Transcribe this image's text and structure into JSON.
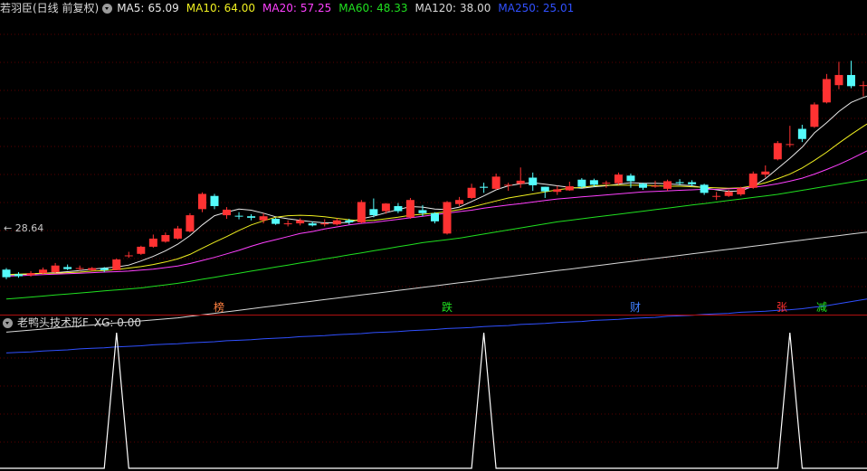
{
  "main_chart": {
    "title": "若羽臣(日线 前复权)",
    "ma_legend": [
      {
        "name": "MA5",
        "value": "65.09",
        "color": "#e8e8e8"
      },
      {
        "name": "MA10",
        "value": "64.00",
        "color": "#f0f020"
      },
      {
        "name": "MA20",
        "value": "57.25",
        "color": "#ff40ff"
      },
      {
        "name": "MA60",
        "value": "48.33",
        "color": "#20e020"
      },
      {
        "name": "MA120",
        "value": "38.00",
        "color": "#d8d8d8"
      },
      {
        "name": "MA250",
        "value": "25.01",
        "color": "#3050ff"
      }
    ],
    "low_label": "← 28.64",
    "markers": [
      {
        "text": "榜",
        "color": "#ff8040",
        "x": 242
      },
      {
        "text": "跌",
        "color": "#20e020",
        "x": 494
      },
      {
        "text": "财",
        "color": "#4080ff",
        "x": 702
      },
      {
        "text": "张",
        "color": "#ff3030",
        "x": 864
      },
      {
        "text": "减",
        "color": "#20e020",
        "x": 908
      }
    ]
  },
  "indicator": {
    "title": "老鸭头技术形F",
    "value_label": "XG: 0.00"
  },
  "chart_data": [
    {
      "type": "candlestick",
      "title": "若羽臣(日线 前复权)",
      "ylim": [
        22,
        80
      ],
      "bars": [
        {
          "o": 30.5,
          "c": 29.0,
          "h": 30.8,
          "l": 28.6
        },
        {
          "o": 29.6,
          "c": 29.2,
          "h": 30.0,
          "l": 28.9
        },
        {
          "o": 29.4,
          "c": 29.8,
          "h": 30.2,
          "l": 29.1
        },
        {
          "o": 29.8,
          "c": 30.5,
          "h": 30.9,
          "l": 29.5
        },
        {
          "o": 30.0,
          "c": 31.3,
          "h": 31.8,
          "l": 29.8
        },
        {
          "o": 31.0,
          "c": 30.6,
          "h": 31.5,
          "l": 30.4
        },
        {
          "o": 30.8,
          "c": 30.8,
          "h": 31.3,
          "l": 30.3
        },
        {
          "o": 30.4,
          "c": 30.8,
          "h": 31.0,
          "l": 30.2
        },
        {
          "o": 30.8,
          "c": 30.4,
          "h": 31.0,
          "l": 30.0
        },
        {
          "o": 30.4,
          "c": 32.5,
          "h": 32.7,
          "l": 30.4
        },
        {
          "o": 33.2,
          "c": 33.3,
          "h": 34.0,
          "l": 32.8
        },
        {
          "o": 33.6,
          "c": 35.0,
          "h": 35.2,
          "l": 33.4
        },
        {
          "o": 35.0,
          "c": 36.6,
          "h": 37.4,
          "l": 34.8
        },
        {
          "o": 36.0,
          "c": 37.3,
          "h": 37.8,
          "l": 35.8
        },
        {
          "o": 36.6,
          "c": 38.6,
          "h": 39.1,
          "l": 36.4
        },
        {
          "o": 38.0,
          "c": 41.2,
          "h": 41.6,
          "l": 37.8
        },
        {
          "o": 42.4,
          "c": 45.4,
          "h": 45.7,
          "l": 41.8
        },
        {
          "o": 45.0,
          "c": 43.0,
          "h": 45.4,
          "l": 42.4
        },
        {
          "o": 41.2,
          "c": 42.3,
          "h": 42.8,
          "l": 40.5
        },
        {
          "o": 41.1,
          "c": 41.0,
          "h": 41.8,
          "l": 40.4
        },
        {
          "o": 41.0,
          "c": 40.7,
          "h": 41.4,
          "l": 40.2
        },
        {
          "o": 40.2,
          "c": 41.0,
          "h": 41.6,
          "l": 39.6
        },
        {
          "o": 40.5,
          "c": 39.5,
          "h": 40.7,
          "l": 39.3
        },
        {
          "o": 39.6,
          "c": 39.6,
          "h": 40.2,
          "l": 39.0
        },
        {
          "o": 39.6,
          "c": 40.2,
          "h": 40.6,
          "l": 39.2
        },
        {
          "o": 39.6,
          "c": 39.2,
          "h": 40.0,
          "l": 39.0
        },
        {
          "o": 39.4,
          "c": 39.6,
          "h": 40.4,
          "l": 39.0
        },
        {
          "o": 39.4,
          "c": 40.2,
          "h": 40.6,
          "l": 39.2
        },
        {
          "o": 40.2,
          "c": 39.8,
          "h": 40.5,
          "l": 39.4
        },
        {
          "o": 39.8,
          "c": 43.8,
          "h": 44.2,
          "l": 39.6
        },
        {
          "o": 42.4,
          "c": 41.2,
          "h": 44.5,
          "l": 40.8
        },
        {
          "o": 42.0,
          "c": 43.5,
          "h": 43.6,
          "l": 41.5
        },
        {
          "o": 43.0,
          "c": 42.0,
          "h": 43.6,
          "l": 41.6
        },
        {
          "o": 40.8,
          "c": 44.2,
          "h": 44.6,
          "l": 40.5
        },
        {
          "o": 42.2,
          "c": 41.6,
          "h": 43.2,
          "l": 41.0
        },
        {
          "o": 41.6,
          "c": 40.0,
          "h": 41.8,
          "l": 39.6
        },
        {
          "o": 37.6,
          "c": 43.8,
          "h": 44.0,
          "l": 37.4
        },
        {
          "o": 43.4,
          "c": 44.2,
          "h": 44.8,
          "l": 43.0
        },
        {
          "o": 44.6,
          "c": 46.6,
          "h": 47.4,
          "l": 44.4
        },
        {
          "o": 46.8,
          "c": 46.6,
          "h": 47.6,
          "l": 45.6
        },
        {
          "o": 46.4,
          "c": 48.8,
          "h": 49.4,
          "l": 46.2
        },
        {
          "o": 47.2,
          "c": 47.2,
          "h": 47.6,
          "l": 46.0
        },
        {
          "o": 47.4,
          "c": 48.0,
          "h": 50.6,
          "l": 46.6
        },
        {
          "o": 48.6,
          "c": 47.1,
          "h": 49.6,
          "l": 46.0
        },
        {
          "o": 46.8,
          "c": 45.9,
          "h": 46.8,
          "l": 44.6
        },
        {
          "o": 45.8,
          "c": 46.3,
          "h": 47.0,
          "l": 45.2
        },
        {
          "o": 46.1,
          "c": 46.9,
          "h": 47.8,
          "l": 46.0
        },
        {
          "o": 48.2,
          "c": 46.8,
          "h": 48.5,
          "l": 46.5
        },
        {
          "o": 48.1,
          "c": 47.2,
          "h": 48.4,
          "l": 46.8
        },
        {
          "o": 47.6,
          "c": 47.6,
          "h": 48.0,
          "l": 46.6
        },
        {
          "o": 47.5,
          "c": 49.2,
          "h": 49.6,
          "l": 47.2
        },
        {
          "o": 49.0,
          "c": 47.9,
          "h": 49.4,
          "l": 46.6
        },
        {
          "o": 47.4,
          "c": 46.6,
          "h": 47.6,
          "l": 46.2
        },
        {
          "o": 47.0,
          "c": 47.0,
          "h": 48.0,
          "l": 46.6
        },
        {
          "o": 46.4,
          "c": 47.9,
          "h": 48.2,
          "l": 46.0
        },
        {
          "o": 47.7,
          "c": 47.5,
          "h": 48.3,
          "l": 47.1
        },
        {
          "o": 47.7,
          "c": 47.3,
          "h": 48.1,
          "l": 46.9
        },
        {
          "o": 47.2,
          "c": 45.6,
          "h": 47.4,
          "l": 45.2
        },
        {
          "o": 45.0,
          "c": 45.0,
          "h": 45.8,
          "l": 44.2
        },
        {
          "o": 45.0,
          "c": 45.8,
          "h": 46.2,
          "l": 44.8
        },
        {
          "o": 45.3,
          "c": 46.5,
          "h": 46.8,
          "l": 45.0
        },
        {
          "o": 46.6,
          "c": 49.4,
          "h": 49.8,
          "l": 46.4
        },
        {
          "o": 49.2,
          "c": 49.8,
          "h": 51.0,
          "l": 48.6
        },
        {
          "o": 52.2,
          "c": 55.4,
          "h": 55.8,
          "l": 52.0
        },
        {
          "o": 55.2,
          "c": 55.2,
          "h": 58.8,
          "l": 54.6
        },
        {
          "o": 58.2,
          "c": 56.2,
          "h": 59.0,
          "l": 55.6
        },
        {
          "o": 58.6,
          "c": 63.0,
          "h": 63.4,
          "l": 58.4
        },
        {
          "o": 63.4,
          "c": 68.0,
          "h": 69.0,
          "l": 63.2
        },
        {
          "o": 66.8,
          "c": 68.8,
          "h": 71.4,
          "l": 66.0
        },
        {
          "o": 68.8,
          "c": 66.6,
          "h": 71.6,
          "l": 66.2
        },
        {
          "o": 66.8,
          "c": 66.8,
          "h": 67.6,
          "l": 64.6
        }
      ],
      "moving_averages": [
        {
          "name": "MA5",
          "color": "#e8e8e8",
          "values": [
            29.4,
            29.5,
            29.6,
            29.8,
            29.9,
            30.1,
            30.3,
            30.6,
            30.8,
            31.0,
            31.4,
            32.2,
            33.1,
            34.2,
            35.5,
            37.2,
            39.3,
            41.1,
            41.8,
            42.4,
            42.2,
            41.6,
            40.9,
            40.5,
            40.2,
            39.9,
            39.7,
            39.7,
            39.8,
            40.5,
            41.0,
            41.7,
            42.3,
            42.9,
            42.8,
            42.4,
            42.3,
            42.8,
            43.9,
            45.0,
            46.2,
            47.0,
            47.4,
            47.6,
            47.3,
            47.0,
            46.7,
            46.5,
            46.8,
            47.0,
            47.3,
            47.6,
            47.5,
            47.5,
            47.4,
            47.2,
            47.0,
            46.6,
            46.2,
            45.9,
            46.0,
            46.9,
            48.4,
            50.4,
            52.4,
            54.6,
            57.4,
            59.4,
            61.6,
            63.4,
            64.4,
            65.1
          ]
        },
        {
          "name": "MA10",
          "color": "#f0f020",
          "values": [
            29.5,
            29.6,
            29.7,
            29.8,
            29.8,
            29.9,
            30.0,
            30.2,
            30.3,
            30.5,
            30.8,
            31.1,
            31.5,
            32.0,
            32.6,
            33.5,
            34.7,
            35.9,
            37.0,
            38.2,
            39.3,
            40.1,
            40.8,
            41.1,
            41.2,
            41.1,
            40.9,
            40.6,
            40.3,
            40.1,
            40.2,
            40.5,
            40.8,
            41.2,
            41.4,
            41.6,
            41.9,
            42.3,
            42.8,
            43.4,
            44.0,
            44.6,
            45.0,
            45.4,
            45.8,
            46.2,
            46.5,
            46.7,
            47.0,
            47.1,
            47.1,
            47.1,
            47.1,
            47.0,
            46.9,
            46.9,
            46.8,
            46.7,
            46.6,
            46.5,
            46.6,
            47.0,
            47.6,
            48.4,
            49.3,
            50.5,
            52.0,
            53.6,
            55.4,
            57.1,
            58.7,
            60.2
          ]
        },
        {
          "name": "MA20",
          "color": "#ff40ff",
          "values": [
            29.2,
            29.3,
            29.4,
            29.5,
            29.6,
            29.7,
            29.8,
            29.9,
            30.0,
            30.1,
            30.2,
            30.4,
            30.6,
            30.9,
            31.2,
            31.7,
            32.3,
            32.9,
            33.6,
            34.3,
            35.1,
            35.8,
            36.4,
            37.0,
            37.6,
            38.0,
            38.5,
            38.9,
            39.3,
            39.6,
            39.8,
            40.1,
            40.4,
            40.7,
            41.0,
            41.3,
            41.6,
            41.9,
            42.2,
            42.6,
            42.9,
            43.2,
            43.5,
            43.8,
            44.1,
            44.4,
            44.6,
            44.8,
            45.0,
            45.2,
            45.4,
            45.6,
            45.8,
            45.9,
            46.0,
            46.1,
            46.2,
            46.3,
            46.3,
            46.4,
            46.5,
            46.7,
            47.0,
            47.4,
            47.9,
            48.5,
            49.3,
            50.2,
            51.2,
            52.3,
            53.5,
            54.7
          ]
        },
        {
          "name": "MA60",
          "color": "#20e020",
          "values": [
            24.7,
            24.9,
            25.1,
            25.3,
            25.5,
            25.7,
            25.9,
            26.1,
            26.3,
            26.5,
            26.7,
            26.9,
            27.2,
            27.5,
            27.8,
            28.2,
            28.6,
            29.0,
            29.4,
            29.8,
            30.2,
            30.6,
            31.0,
            31.4,
            31.8,
            32.2,
            32.6,
            33.0,
            33.4,
            33.8,
            34.2,
            34.6,
            35.0,
            35.4,
            35.8,
            36.1,
            36.4,
            36.7,
            37.1,
            37.5,
            37.9,
            38.3,
            38.7,
            39.1,
            39.5,
            39.9,
            40.2,
            40.5,
            40.8,
            41.1,
            41.4,
            41.7,
            42.0,
            42.3,
            42.6,
            42.9,
            43.2,
            43.5,
            43.8,
            44.1,
            44.4,
            44.7,
            45.0,
            45.3,
            45.7,
            46.1,
            46.5,
            46.9,
            47.3,
            47.7,
            48.1,
            48.5
          ]
        },
        {
          "name": "MA120",
          "color": "#d8d8d8",
          "values": [
            18.2,
            18.4,
            18.6,
            18.8,
            19.0,
            19.2,
            19.4,
            19.6,
            19.8,
            20.0,
            20.2,
            20.4,
            20.6,
            20.8,
            21.0,
            21.3,
            21.6,
            21.9,
            22.2,
            22.5,
            22.8,
            23.1,
            23.4,
            23.7,
            24.0,
            24.3,
            24.6,
            24.9,
            25.2,
            25.5,
            25.8,
            26.1,
            26.4,
            26.7,
            27.0,
            27.3,
            27.6,
            27.9,
            28.2,
            28.5,
            28.8,
            29.1,
            29.4,
            29.7,
            30.0,
            30.3,
            30.6,
            30.9,
            31.2,
            31.5,
            31.8,
            32.1,
            32.4,
            32.7,
            33.0,
            33.3,
            33.6,
            33.9,
            34.2,
            34.5,
            34.8,
            35.1,
            35.4,
            35.7,
            36.0,
            36.3,
            36.6,
            36.9,
            37.2,
            37.5,
            37.8,
            38.0
          ]
        },
        {
          "name": "MA250",
          "color": "#3050ff",
          "values": [
            14.1,
            14.2,
            14.3,
            14.5,
            14.6,
            14.7,
            14.9,
            15.0,
            15.1,
            15.3,
            15.4,
            15.5,
            15.7,
            15.8,
            15.9,
            16.1,
            16.2,
            16.3,
            16.5,
            16.6,
            16.7,
            16.9,
            17.0,
            17.1,
            17.3,
            17.4,
            17.5,
            17.7,
            17.8,
            17.9,
            18.1,
            18.2,
            18.3,
            18.5,
            18.6,
            18.7,
            18.9,
            19.0,
            19.1,
            19.3,
            19.4,
            19.5,
            19.7,
            19.8,
            19.9,
            20.1,
            20.2,
            20.3,
            20.5,
            20.6,
            20.7,
            20.9,
            21.0,
            21.1,
            21.3,
            21.4,
            21.5,
            21.7,
            21.8,
            21.9,
            22.1,
            22.2,
            22.3,
            22.5,
            22.6,
            22.8,
            23.1,
            23.4,
            23.8,
            24.2,
            24.6,
            25.0
          ]
        }
      ]
    },
    {
      "type": "line",
      "title": "老鸭头技术形F",
      "ylim": [
        0,
        1
      ],
      "series": [
        {
          "values": [
            0,
            0,
            0,
            0,
            0,
            0,
            0,
            0,
            0,
            1,
            0,
            0,
            0,
            0,
            0,
            0,
            0,
            0,
            0,
            0,
            0,
            0,
            0,
            0,
            0,
            0,
            0,
            0,
            0,
            0,
            0,
            0,
            0,
            0,
            0,
            0,
            0,
            0,
            0,
            1,
            0,
            0,
            0,
            0,
            0,
            0,
            0,
            0,
            0,
            0,
            0,
            0,
            0,
            0,
            0,
            0,
            0,
            0,
            0,
            0,
            0,
            0,
            0,
            0,
            1,
            0,
            0,
            0,
            0,
            0,
            0,
            0
          ]
        }
      ]
    }
  ]
}
